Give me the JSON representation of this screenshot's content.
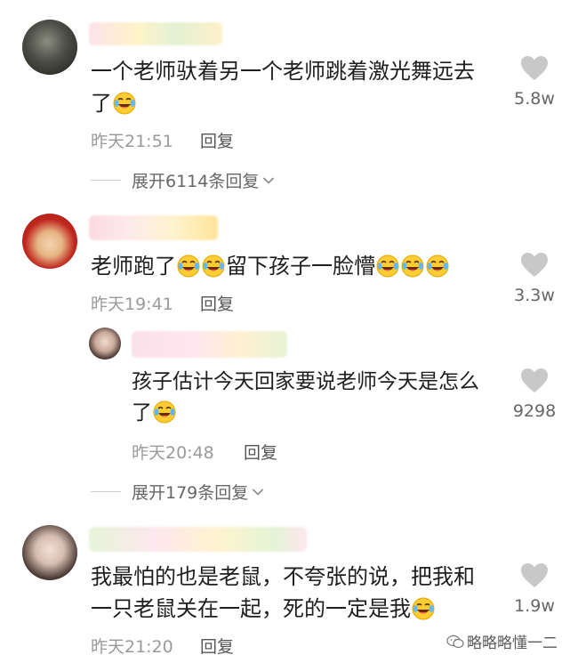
{
  "colors": {
    "like_icon": "#c8c8c8",
    "meta": "#9a9a9a",
    "text": "#1e1e1e"
  },
  "comments": [
    {
      "text": "一个老师驮着另一个老师跳着激光舞远去",
      "text_cont": "了",
      "time": "昨天21:51",
      "reply": "回复",
      "likes": "5.8w",
      "expand": "展开6114条回复"
    },
    {
      "text_a": "老师跑了",
      "text_b": "留下孩子一脸懵",
      "time": "昨天19:41",
      "reply": "回复",
      "likes": "3.3w",
      "sub_reply": {
        "text": "孩子估计今天回家要说老师今天是怎么",
        "text_cont": "了",
        "time": "昨天20:48",
        "reply": "回复",
        "likes": "9298"
      },
      "expand": "展开179条回复"
    },
    {
      "text": "我最怕的也是老鼠，不夸张的说，把我和",
      "text_cont": "一只老鼠关在一起，死的一定是我",
      "time": "昨天21:20",
      "reply": "回复",
      "likes": "1.9w"
    }
  ],
  "watermark": "略略略懂一二",
  "icons": [
    "heart-icon",
    "laughing-crying-emoji",
    "chevron-down-icon",
    "wechat-icon"
  ]
}
